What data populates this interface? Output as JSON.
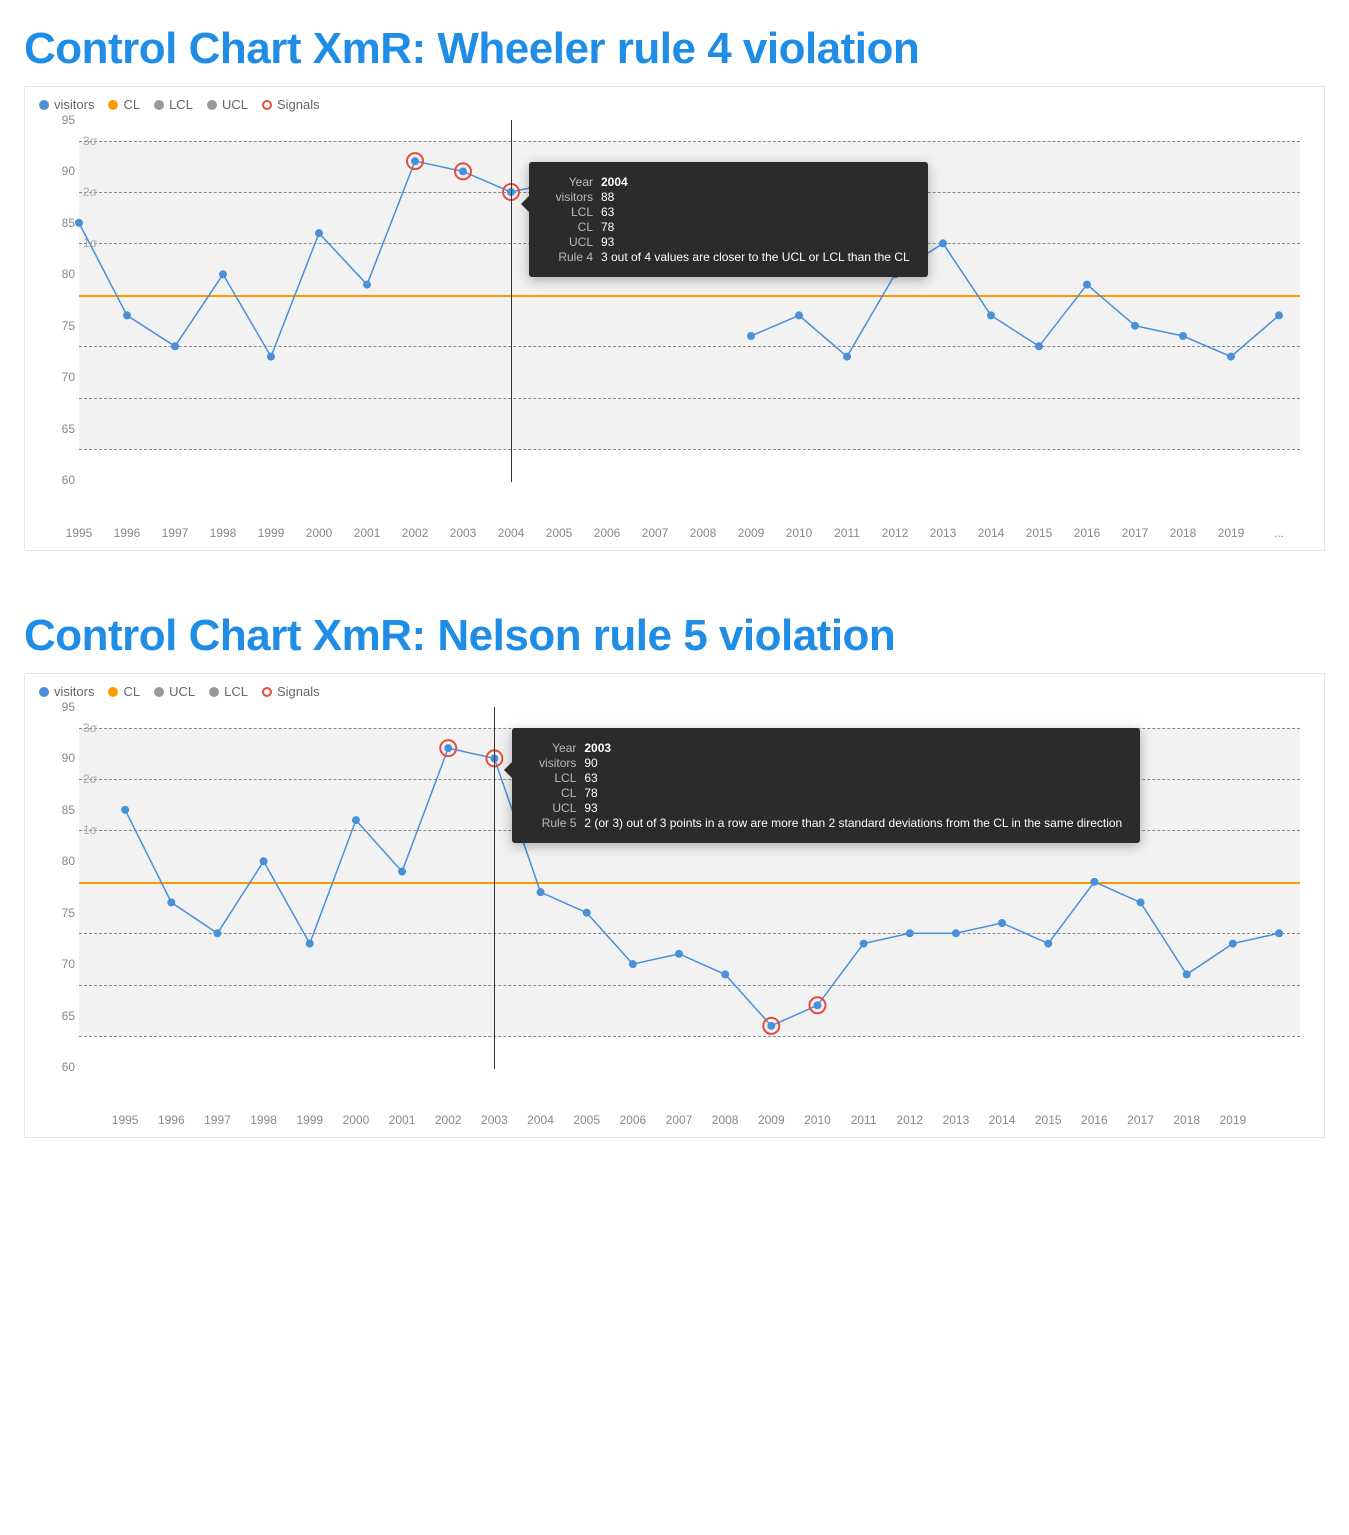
{
  "chart_data": [
    {
      "type": "line",
      "title": "Control Chart XmR: Wheeler rule 4 violation",
      "xlabel": "",
      "ylabel": "",
      "ylim": [
        60,
        95
      ],
      "categories": [
        "1995",
        "1996",
        "1997",
        "1998",
        "1999",
        "2000",
        "2001",
        "2002",
        "2003",
        "2004",
        "2005",
        "2006",
        "2007",
        "2008",
        "2009",
        "2010",
        "2011",
        "2012",
        "2013",
        "2014",
        "2015",
        "2016",
        "2017",
        "2018",
        "2019",
        "..."
      ],
      "series": [
        {
          "name": "visitors",
          "values": [
            85,
            76,
            73,
            80,
            72,
            84,
            79,
            91,
            90,
            88,
            89,
            null,
            null,
            null,
            74,
            76,
            72,
            80,
            83,
            76,
            73,
            79,
            75,
            74,
            72,
            76
          ]
        }
      ],
      "signals_idx": [
        7,
        8,
        9,
        10
      ],
      "lines": {
        "CL": 78,
        "LCL": 63,
        "UCL": 93,
        "sigma": [
          {
            "label": "1σ",
            "low": 73,
            "high": 83
          },
          {
            "label": "2σ",
            "low": 68,
            "high": 88
          },
          {
            "label": "3σ",
            "low": 63,
            "high": 93
          }
        ]
      },
      "vline_x": "2004",
      "legend": [
        {
          "label": "visitors",
          "type": "filled",
          "color": "#4a90d9"
        },
        {
          "label": "CL",
          "type": "filled",
          "color": "#ff9900"
        },
        {
          "label": "LCL",
          "type": "filled",
          "color": "#999"
        },
        {
          "label": "UCL",
          "type": "filled",
          "color": "#999"
        },
        {
          "label": "Signals",
          "type": "open",
          "color": "#e74c3c"
        }
      ],
      "tooltip": {
        "anchor_x": "2004",
        "anchor_y": 88,
        "rows": [
          {
            "label": "Year",
            "value": "2004",
            "bold": true
          },
          {
            "label": "visitors",
            "value": "88"
          },
          {
            "label": "LCL",
            "value": "63"
          },
          {
            "label": "CL",
            "value": "78"
          },
          {
            "label": "UCL",
            "value": "93"
          },
          {
            "label": "Rule 4",
            "value": "3 out of 4 values are closer to the UCL or LCL than the CL"
          }
        ]
      }
    },
    {
      "type": "line",
      "title": "Control Chart XmR: Nelson rule 5 violation",
      "xlabel": "",
      "ylabel": "",
      "ylim": [
        60,
        95
      ],
      "categories": [
        "",
        "1995",
        "1996",
        "1997",
        "1998",
        "1999",
        "2000",
        "2001",
        "2002",
        "2003",
        "2004",
        "2005",
        "2006",
        "2007",
        "2008",
        "2009",
        "2010",
        "2011",
        "2012",
        "2013",
        "2014",
        "2015",
        "2016",
        "2017",
        "2018",
        "2019",
        ""
      ],
      "series": [
        {
          "name": "visitors",
          "values": [
            null,
            85,
            76,
            73,
            80,
            72,
            84,
            79,
            91,
            90,
            77,
            75,
            70,
            71,
            69,
            64,
            66,
            72,
            73,
            73,
            74,
            72,
            78,
            76,
            69,
            72,
            73
          ]
        }
      ],
      "signals_idx": [
        8,
        9,
        15,
        16
      ],
      "lines": {
        "CL": 78,
        "LCL": 63,
        "UCL": 93,
        "sigma": [
          {
            "label": "1σ",
            "low": 73,
            "high": 83
          },
          {
            "label": "2σ",
            "low": 68,
            "high": 88
          },
          {
            "label": "3σ",
            "low": 63,
            "high": 93
          }
        ]
      },
      "vline_x": "2003",
      "legend": [
        {
          "label": "visitors",
          "type": "filled",
          "color": "#4a90d9"
        },
        {
          "label": "CL",
          "type": "filled",
          "color": "#ff9900"
        },
        {
          "label": "UCL",
          "type": "filled",
          "color": "#999"
        },
        {
          "label": "LCL",
          "type": "filled",
          "color": "#999"
        },
        {
          "label": "Signals",
          "type": "open",
          "color": "#e74c3c"
        }
      ],
      "tooltip": {
        "anchor_x": "2003",
        "anchor_y": 90,
        "rows": [
          {
            "label": "Year",
            "value": "2003",
            "bold": true
          },
          {
            "label": "visitors",
            "value": "90"
          },
          {
            "label": "LCL",
            "value": "63"
          },
          {
            "label": "CL",
            "value": "78"
          },
          {
            "label": "UCL",
            "value": "93"
          },
          {
            "label": "Rule 5",
            "value": "2 (or 3) out of 3 points in a row are more than 2 standard deviations from the CL in the same direction"
          }
        ]
      }
    }
  ]
}
